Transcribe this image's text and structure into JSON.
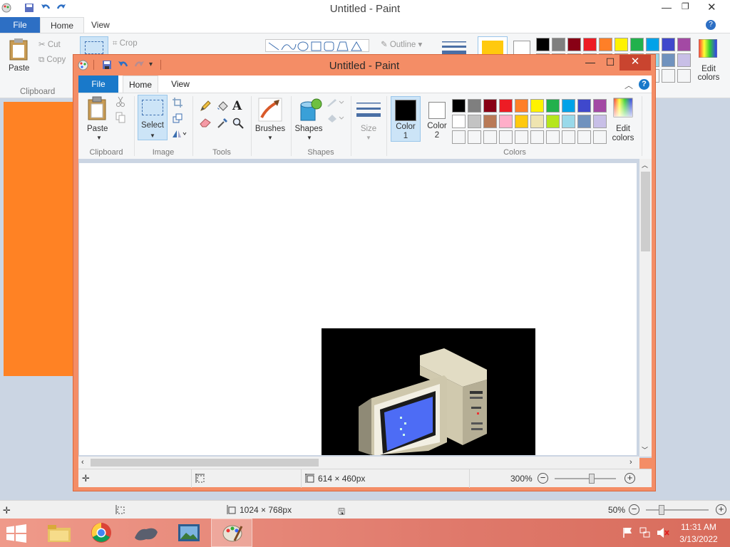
{
  "bg_window": {
    "title": "Untitled - Paint",
    "tabs": {
      "file": "File",
      "home": "Home",
      "view": "View"
    },
    "ribbon": {
      "paste": "Paste",
      "cut": "Cut",
      "copy": "Copy",
      "crop": "Crop",
      "clipboard": "Clipboard",
      "outline": "Outline",
      "edit_colors": "Edit colors"
    },
    "status": {
      "dimensions": "1024 × 768px",
      "zoom": "50%"
    }
  },
  "window": {
    "title": "Untitled - Paint",
    "min": "—",
    "max": "☐",
    "close": "✕"
  },
  "tabs": {
    "file": "File",
    "home": "Home",
    "view": "View"
  },
  "ribbon": {
    "clipboard": {
      "label": "Clipboard",
      "paste": "Paste"
    },
    "image": {
      "label": "Image",
      "select": "Select"
    },
    "tools": {
      "label": "Tools"
    },
    "brushes": "Brushes",
    "shapes": {
      "label": "Shapes",
      "button": "Shapes"
    },
    "size": "Size",
    "colors": {
      "label": "Colors",
      "color1_a": "Color",
      "color1_b": "1",
      "color2_a": "Color",
      "color2_b": "2",
      "edit_a": "Edit",
      "edit_b": "colors",
      "palette_row1": [
        "#000000",
        "#7f7f7f",
        "#880015",
        "#ed1c24",
        "#ff7f27",
        "#fff200",
        "#22b14c",
        "#00a2e8",
        "#3f48cc",
        "#a349a4"
      ],
      "palette_row2": [
        "#ffffff",
        "#c3c3c3",
        "#b97a57",
        "#ffaec9",
        "#ffc90e",
        "#efe4b0",
        "#b5e61d",
        "#99d9ea",
        "#7092be",
        "#c8bfe7"
      ]
    }
  },
  "status": {
    "image_size": "614 × 460px",
    "zoom": "300%"
  },
  "taskbar": {
    "time": "11:31 AM",
    "date": "3/13/2022"
  }
}
